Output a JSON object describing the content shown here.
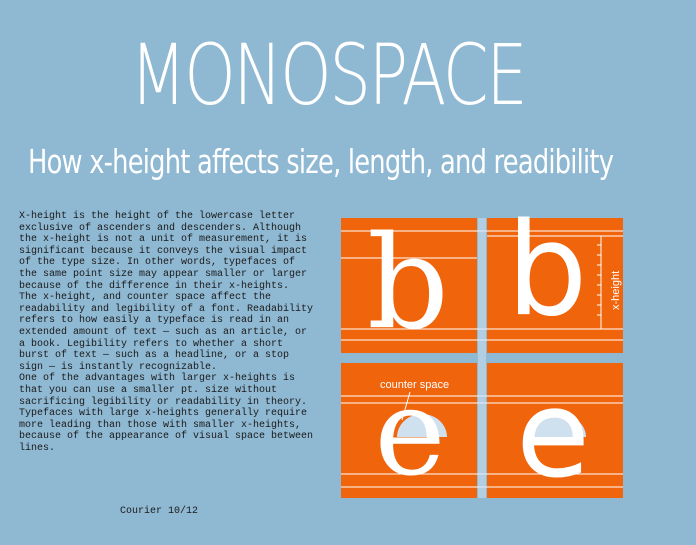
{
  "header": {
    "title": "MONOSPACE",
    "subtitle": "How x-height affects size, length, and readibility"
  },
  "body": {
    "paragraphs": [
      "X-height is the height of the lowercase letter exclusive of ascenders and descenders. Although the x-height is not a unit of measurement, it is significant because it conveys the visual impact of the type size. In other words, typefaces of the same point size may appear smaller or larger because of the difference in their x-heights.",
      " The x-height, and counter space affect the readability and legibility of a font. Readability refers to how easily a typeface is read in an extended amount of text — such as an article, or a book. Legibility refers to whether a short burst of text — such as a headline, or a stop sign — is instantly recognizable.",
      " One of the advantages with larger x-heights is that you can use a smaller pt. size without sacrificing legibility or readability in theory.",
      " Typefaces with large x-heights generally require more leading than those with smaller x-heights, because of the appearance of visual space between lines."
    ],
    "caption": "Courier 10/12"
  },
  "diagram": {
    "letters": [
      "b",
      "b",
      "e",
      "e"
    ],
    "xheight_label": "x-height",
    "counter_label": "counter space",
    "colors": {
      "background": "#8fb8d2",
      "panel": "#f0640c",
      "letter": "#ffffff",
      "counter_fill": "#cfe0ee",
      "guide": "#ffffff"
    }
  }
}
